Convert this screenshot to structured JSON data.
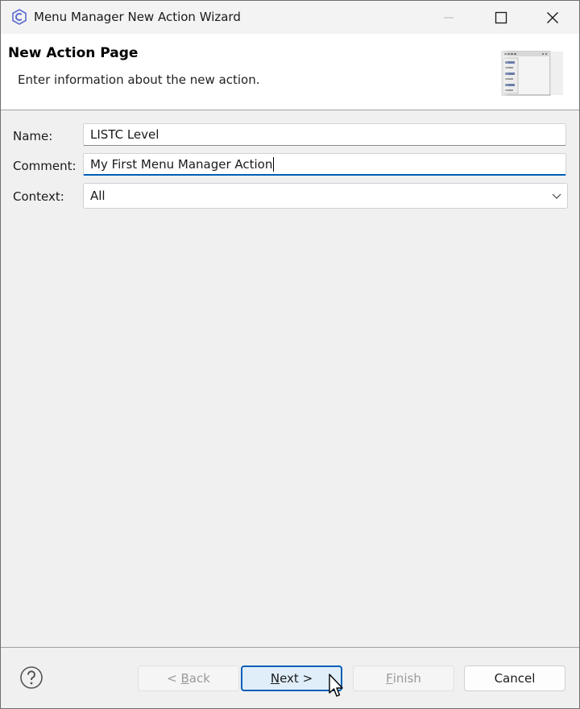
{
  "window": {
    "title": "Menu Manager New Action Wizard",
    "controls": {
      "minimize_icon": "minimize-icon",
      "maximize_icon": "maximize-icon",
      "close_icon": "close-icon"
    }
  },
  "header": {
    "title": "New Action Page",
    "description": "Enter information about the new action.",
    "image_icon": "wizard-banner-icon"
  },
  "form": {
    "name": {
      "label": "Name:",
      "value": "LISTC Level"
    },
    "comment": {
      "label": "Comment:",
      "value": "My First Menu Manager Action"
    },
    "context": {
      "label": "Context:",
      "selected": "All"
    }
  },
  "footer": {
    "help_icon": "help-icon",
    "back": {
      "prefix": "< ",
      "mnemonic": "B",
      "rest": "ack"
    },
    "next": {
      "mnemonic": "N",
      "rest": "ext >"
    },
    "finish": {
      "mnemonic": "F",
      "rest": "inish"
    },
    "cancel": "Cancel"
  },
  "colors": {
    "accent": "#005fb8",
    "window_bg": "#f0f0f0",
    "banner_bg": "#ffffff"
  }
}
